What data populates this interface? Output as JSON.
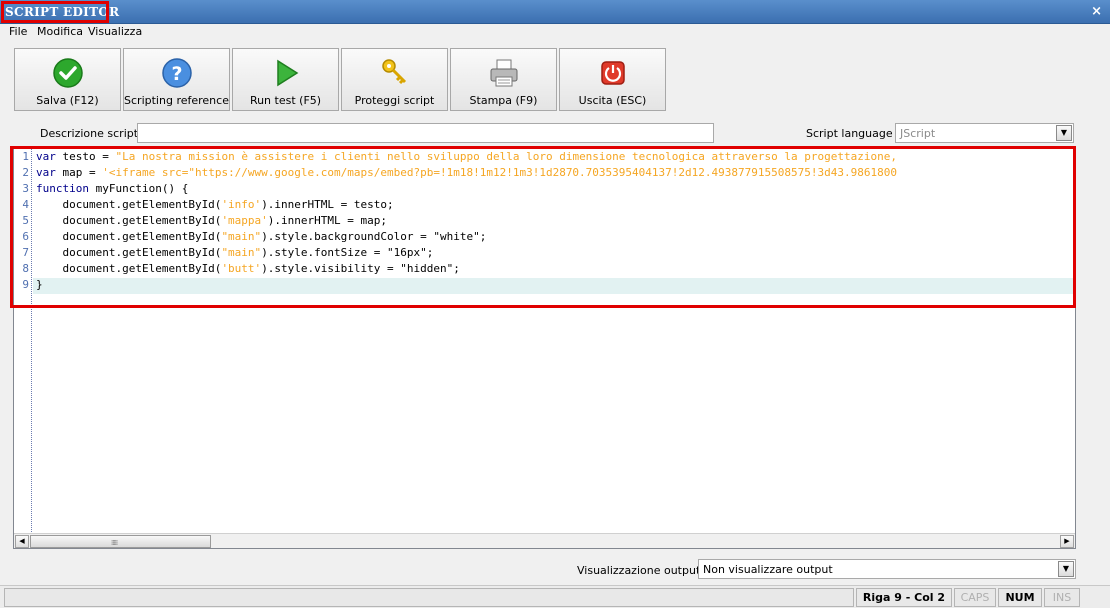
{
  "window": {
    "title": "SCRIPT EDITOR",
    "close_icon": "close-icon"
  },
  "menu": {
    "file": "File",
    "modifica": "Modifica",
    "visualizza": "Visualizza"
  },
  "toolbar": {
    "salva": {
      "label": "Salva (F12)",
      "icon": "check-icon"
    },
    "reference": {
      "label": "Scripting reference",
      "icon": "help-icon"
    },
    "run": {
      "label": "Run test (F5)",
      "icon": "play-icon"
    },
    "proteggi": {
      "label": "Proteggi script",
      "icon": "key-icon"
    },
    "stampa": {
      "label": "Stampa (F9)",
      "icon": "printer-icon"
    },
    "uscita": {
      "label": "Uscita (ESC)",
      "icon": "power-icon"
    }
  },
  "form": {
    "description_label": "Descrizione script :",
    "description_value": "",
    "language_label": "Script language :",
    "language_value": "JScript",
    "output_label": "Visualizzazione output :",
    "output_value": "Non visualizzare output"
  },
  "editor": {
    "line_numbers": [
      "1",
      "2",
      "3",
      "4",
      "5",
      "6",
      "7",
      "8",
      "9"
    ],
    "current_line": 9,
    "lines": [
      {
        "kw": "var",
        "rest": " testo = ",
        "str": "\"La nostra mission è assistere i clienti nello sviluppo della loro dimensione tecnologica attraverso la progettazione,",
        "tail": ""
      },
      {
        "kw": "var",
        "rest": " map = ",
        "str": "'<iframe src=\"https://www.google.com/maps/embed?pb=!1m18!1m12!1m3!1d2870.7035395404137!2d12.493877915508575!3d43.9861800",
        "tail": ""
      },
      {
        "kw": "function",
        "rest": " myFunction() {",
        "str": "",
        "tail": ""
      },
      {
        "kw": "",
        "rest": "    document.getElementById(",
        "str": "'info'",
        "tail": ").innerHTML = testo;"
      },
      {
        "kw": "",
        "rest": "    document.getElementById(",
        "str": "'mappa'",
        "tail": ").innerHTML = map;"
      },
      {
        "kw": "",
        "rest": "    document.getElementById(",
        "str": "\"main\"",
        "tail": ").style.backgroundColor = \"white\";"
      },
      {
        "kw": "",
        "rest": "    document.getElementById(",
        "str": "\"main\"",
        "tail": ").style.fontSize = \"16px\";"
      },
      {
        "kw": "",
        "rest": "    document.getElementById(",
        "str": "'butt'",
        "tail": ").style.visibility = \"hidden\";"
      },
      {
        "kw": "",
        "rest": "}",
        "str": "",
        "tail": ""
      }
    ]
  },
  "status": {
    "position": "Riga 9 - Col 2",
    "caps": "CAPS",
    "num": "NUM",
    "ins": "INS"
  },
  "colors": {
    "title_bg": "#3b6fb0",
    "highlight": "#e00000",
    "keyword": "#00008b",
    "string": "#f5a623"
  }
}
